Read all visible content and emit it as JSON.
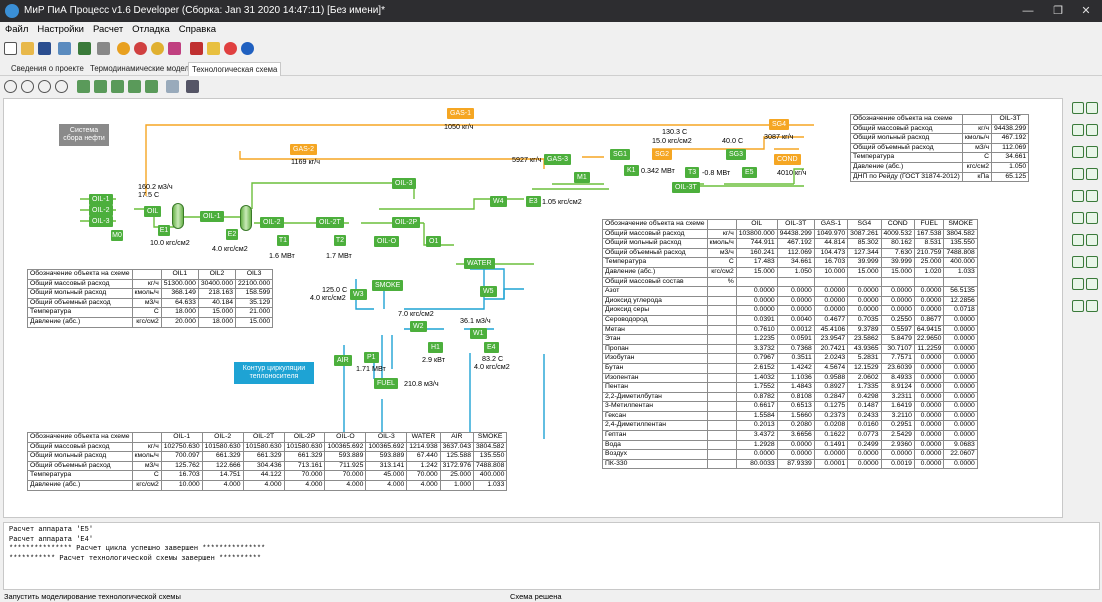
{
  "app": {
    "title": "МиР ПиА Процесс v1.6 Developer (Сборка: Jan 31 2020 14:47:11) [Без имени]*"
  },
  "menu": [
    "Файл",
    "Настройки",
    "Расчет",
    "Отладка",
    "Справка"
  ],
  "tabs": [
    "Сведения о проекте",
    "Термодинамические модели",
    "Технологическая схема"
  ],
  "active_tab": 2,
  "scheme": {
    "callout_collect": "Система сбора нефти",
    "callout_contour": "Контур циркуляции теплоносителя",
    "labels": {
      "gas1_flow": "1050 кг/ч",
      "gas2_flow": "1169 кг/ч",
      "gas3_flow": "5927 кг/ч",
      "flow_m3": "160.2 м3/ч",
      "temp_in": "17.5 С",
      "p_e1": "10.0 кгс/см2",
      "p_e2": "4.0 кгс/см2",
      "t1_power": "1.6 МВт",
      "t2_power": "1.7 МВт",
      "t2_temp": "125.0 С",
      "t2_p": "4.0 кгс/см2",
      "sg2_temp": "130.3 С",
      "sg2_p": "15.0 кгс/см2",
      "sg3_temp": "40.0 С",
      "sg4_flow": "3087 кг/ч",
      "k1_power": "0.342 МВт",
      "t3_power": "-0.8 МВт",
      "cond_flow": "4010 кг/ч",
      "e3_p": "1.05 кгс/см2",
      "w2_p": "7.0 кгс/см2",
      "w1_flow": "36.1 м3/ч",
      "h1_power": "2.9 кВт",
      "e4_temp": "83.2 С",
      "e4_p": "4.0 кгс/см2",
      "p1_power": "1.71 МВт",
      "fuel_flow": "210.8 м3/ч"
    },
    "tags": {
      "oil1": "OIL-1",
      "oil2": "OIL-2",
      "oil3": "OIL-3",
      "oil": "OIL",
      "m0": "M0",
      "e1": "E1",
      "e2": "E2",
      "t1": "T1",
      "t2": "T2",
      "oil2t": "OIL-2T",
      "oil2p": "OIL-2P",
      "oilo": "OIL-O",
      "o1": "O1",
      "water": "WATER",
      "w4": "W4",
      "w5": "W5",
      "w3": "W3",
      "w2": "W2",
      "w1": "W1",
      "h1": "H1",
      "e4": "E4",
      "smoke": "SMOKE",
      "air": "AIR",
      "p1": "P1",
      "fuel": "FUEL",
      "gas1": "GAS-1",
      "gas2": "GAS-2",
      "gas3": "GAS-3",
      "m1": "M1",
      "sg1": "SG1",
      "sg2": "SG2",
      "sg3": "SG3",
      "sg4": "SG4",
      "k1": "K1",
      "t3": "T3",
      "e5": "E5",
      "cond": "COND",
      "oil3t": "OIL-3T",
      "e3": "E3"
    }
  },
  "table_top": {
    "header": [
      "Обозначение объекта на схеме",
      "",
      "OIL-3T"
    ],
    "rows": [
      [
        "Общий массовый расход",
        "кг/ч",
        "94438.299"
      ],
      [
        "Общий мольный расход",
        "кмоль/ч",
        "467.192"
      ],
      [
        "Общий объемный расход",
        "м3/ч",
        "112.069"
      ],
      [
        "Температура",
        "С",
        "34.661"
      ],
      [
        "Давление (абс.)",
        "кгс/см2",
        "1.050"
      ],
      [
        "ДНП по Рейду (ГОСТ 31874-2012)",
        "кПа",
        "65.125"
      ]
    ]
  },
  "table_oil": {
    "header": [
      "Обозначение объекта на схеме",
      "",
      "OIL1",
      "OIL2",
      "OIL3"
    ],
    "rows": [
      [
        "Общий массовый расход",
        "кг/ч",
        "51300.000",
        "30400.000",
        "22100.000"
      ],
      [
        "Общий мольный расход",
        "кмоль/ч",
        "368.149",
        "218.163",
        "158.599"
      ],
      [
        "Общий объемный расход",
        "м3/ч",
        "64.633",
        "40.184",
        "35.129"
      ],
      [
        "Температура",
        "С",
        "18.000",
        "15.000",
        "21.000"
      ],
      [
        "Давление (абс.)",
        "кгс/см2",
        "20.000",
        "18.000",
        "15.000"
      ]
    ]
  },
  "table_bottom": {
    "header": [
      "Обозначение объекта на схеме",
      "",
      "OIL-1",
      "OIL-2",
      "OIL-2T",
      "OIL-2P",
      "OIL-O",
      "OIL-3",
      "WATER",
      "AIR",
      "SMOKE"
    ],
    "rows": [
      [
        "Общий массовый расход",
        "кг/ч",
        "102750.630",
        "101580.630",
        "101580.630",
        "101580.630",
        "100365.692",
        "100365.692",
        "1214.938",
        "3637.043",
        "3804.582"
      ],
      [
        "Общий мольный расход",
        "кмоль/ч",
        "700.097",
        "661.329",
        "661.329",
        "661.329",
        "593.889",
        "593.889",
        "67.440",
        "125.588",
        "135.550"
      ],
      [
        "Общий объемный расход",
        "м3/ч",
        "125.762",
        "122.666",
        "304.436",
        "713.161",
        "711.925",
        "313.141",
        "1.242",
        "3172.976",
        "7488.808"
      ],
      [
        "Температура",
        "С",
        "16.703",
        "14.751",
        "44.122",
        "70.000",
        "70.000",
        "45.000",
        "70.000",
        "25.000",
        "400.000"
      ],
      [
        "Давление (абс.)",
        "кгс/см2",
        "10.000",
        "4.000",
        "4.000",
        "4.000",
        "4.000",
        "4.000",
        "4.000",
        "1.000",
        "1.033"
      ]
    ]
  },
  "table_comp": {
    "header": [
      "Обозначение объекта на схеме",
      "",
      "OIL",
      "OIL-3T",
      "GAS-1",
      "SG4",
      "COND",
      "FUEL",
      "SMOKE"
    ],
    "rows": [
      [
        "Общий массовый расход",
        "кг/ч",
        "103800.000",
        "94438.299",
        "1049.970",
        "3087.261",
        "4009.532",
        "167.538",
        "3804.582"
      ],
      [
        "Общий мольный расход",
        "кмоль/ч",
        "744.911",
        "467.192",
        "44.814",
        "85.302",
        "80.162",
        "8.531",
        "135.550"
      ],
      [
        "Общий объемный расход",
        "м3/ч",
        "160.241",
        "112.069",
        "104.473",
        "127.344",
        "7.630",
        "210.759",
        "7488.808"
      ],
      [
        "Температура",
        "С",
        "17.483",
        "34.661",
        "16.703",
        "39.999",
        "39.999",
        "25.000",
        "400.000"
      ],
      [
        "Давление (абс.)",
        "кгс/см2",
        "15.000",
        "1.050",
        "10.000",
        "15.000",
        "15.000",
        "1.020",
        "1.033"
      ],
      [
        "Общий массовый состав",
        "%",
        "",
        "",
        "",
        "",
        "",
        "",
        ""
      ],
      [
        "Азот",
        "",
        "0.0000",
        "0.0000",
        "0.0000",
        "0.0000",
        "0.0000",
        "0.0000",
        "56.5135"
      ],
      [
        "Диоксид углерода",
        "",
        "0.0000",
        "0.0000",
        "0.0000",
        "0.0000",
        "0.0000",
        "0.0000",
        "12.2856"
      ],
      [
        "Диоксид серы",
        "",
        "0.0000",
        "0.0000",
        "0.0000",
        "0.0000",
        "0.0000",
        "0.0000",
        "0.0718"
      ],
      [
        "Сероводород",
        "",
        "0.0391",
        "0.0040",
        "0.4677",
        "0.7035",
        "0.2550",
        "0.8677",
        "0.0000"
      ],
      [
        "Метан",
        "",
        "0.7610",
        "0.0012",
        "45.4106",
        "9.3789",
        "0.5597",
        "64.9415",
        "0.0000"
      ],
      [
        "Этан",
        "",
        "1.2235",
        "0.0591",
        "23.9547",
        "23.5862",
        "5.8479",
        "22.9650",
        "0.0000"
      ],
      [
        "Пропан",
        "",
        "3.3732",
        "0.7368",
        "20.7421",
        "43.9365",
        "30.7107",
        "11.2259",
        "0.0000"
      ],
      [
        "Изобутан",
        "",
        "0.7967",
        "0.3511",
        "2.0243",
        "5.2831",
        "7.7571",
        "0.0000",
        "0.0000"
      ],
      [
        "Бутан",
        "",
        "2.6152",
        "1.4242",
        "4.5674",
        "12.1529",
        "23.6039",
        "0.0000",
        "0.0000"
      ],
      [
        "Изопентан",
        "",
        "1.4032",
        "1.1036",
        "0.9588",
        "2.0602",
        "8.4933",
        "0.0000",
        "0.0000"
      ],
      [
        "Пентан",
        "",
        "1.7552",
        "1.4843",
        "0.8927",
        "1.7335",
        "8.9124",
        "0.0000",
        "0.0000"
      ],
      [
        "2,2-Диметилбутан",
        "",
        "0.8782",
        "0.8108",
        "0.2847",
        "0.4298",
        "3.2311",
        "0.0000",
        "0.0000"
      ],
      [
        "3-Метилпентан",
        "",
        "0.6617",
        "0.6513",
        "0.1275",
        "0.1487",
        "1.6419",
        "0.0000",
        "0.0000"
      ],
      [
        "Гексан",
        "",
        "1.5584",
        "1.5660",
        "0.2373",
        "0.2433",
        "3.2110",
        "0.0000",
        "0.0000"
      ],
      [
        "2,4-Диметилпентан",
        "",
        "0.2013",
        "0.2080",
        "0.0208",
        "0.0160",
        "0.2951",
        "0.0000",
        "0.0000"
      ],
      [
        "Гептан",
        "",
        "3.4372",
        "3.6656",
        "0.1622",
        "0.0773",
        "2.5429",
        "0.0000",
        "0.0000"
      ],
      [
        "Вода",
        "",
        "1.2928",
        "0.0000",
        "0.1491",
        "0.2499",
        "2.9360",
        "0.0000",
        "9.0683"
      ],
      [
        "Воздух",
        "",
        "0.0000",
        "0.0000",
        "0.0000",
        "0.0000",
        "0.0000",
        "0.0000",
        "22.0607"
      ],
      [
        "ПК-330",
        "",
        "80.0033",
        "87.9339",
        "0.0001",
        "0.0000",
        "0.0019",
        "0.0000",
        "0.0000"
      ]
    ]
  },
  "log": [
    "Расчет аппарата 'E5'",
    "Расчет аппарата 'E4'",
    "",
    "*************** Расчет цикла успешно завершен ***************",
    "",
    "*********** Расчет технологической схемы завершен **********"
  ],
  "status": {
    "left": "Запустить моделирование технологической схемы",
    "center": "Схема решена"
  },
  "colors": {
    "stream_green": "#4caf3c",
    "gas_orange": "#f5a623",
    "water_blue": "#1ea3d4",
    "canvas": "#ffffff"
  }
}
